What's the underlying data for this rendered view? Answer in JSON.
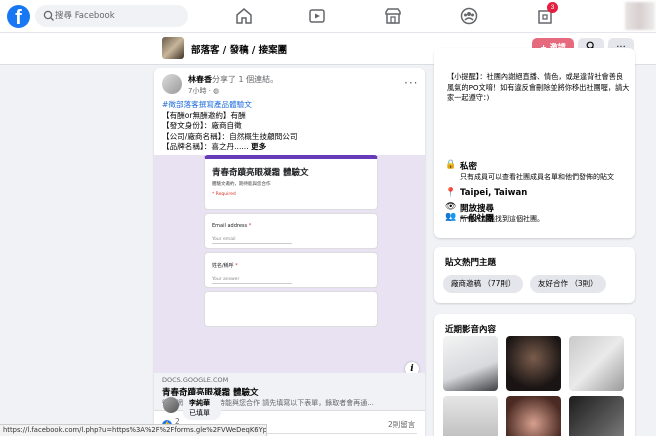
{
  "nav": {
    "logo_letter": "f",
    "search_placeholder": "搜尋 Facebook",
    "notification_count": "3"
  },
  "group": {
    "name": "部落客 / 發稿 / 接案團",
    "invite_label": "+ 邀請",
    "search_btn": "⌕",
    "more_btn": "···"
  },
  "post": {
    "author": "林春香",
    "action": "分享了 1 個連結。",
    "time": "7小時 · ",
    "more": "···",
    "tag": "#徵部落客撰寫產品體驗文",
    "lines": [
      "【有酬or無酬邀約】有酬",
      "【發文身份】：廠商自徵",
      "【公司/廠商名稱】：自然概生技顧問公司"
    ],
    "last_line": "【品牌名稱】：喜之丹...... ",
    "see_more": "更多",
    "form": {
      "title": "青春奇蹟亮眼凝霜 體驗文",
      "desc": "體驗文邀約，期待能與您合作",
      "required": "* Required",
      "field1_label": "Email address",
      "field1_placeholder": "Your email",
      "field2_label": "姓名/稱呼",
      "field2_placeholder": "Your answer"
    },
    "info_icon": "i",
    "link": {
      "domain": "DOCS.GOOGLE.COM",
      "title": "青春奇蹟亮眼凝霜 體驗文",
      "desc": "徵求網紅網美，期待能與您合作 請先填寫以下表單，錄取者會再通..."
    },
    "reaction_count": "2",
    "comment_count": "2則留言",
    "like_label": "讚",
    "comment_label": "留言",
    "comment": {
      "name": "李純華",
      "text": "已填單"
    }
  },
  "statusbar": "https://l.facebook.com/l.php?u=https%3A%2F%2Fforms.gle%2FVWeDeqK6YpJT...",
  "about": {
    "rules": "【小提醒】：社團內謝絕直播、情色，或是違背社會善良風氣的PO文唷！如有違反會刪除並將你移出社團喔，請大家一起遵守：)",
    "private_title": "私密",
    "private_desc": "只有成員可以查看社團成員名單和他們發佈的貼文",
    "visible_title": "開放搜尋",
    "visible_desc": "所有人都能找到這個社團。",
    "location": "Taipei, Taiwan",
    "type": "一般社團"
  },
  "topics": {
    "title": "貼文熱門主題",
    "chips": [
      "廠商邀稿 （77則）",
      "友好合作 （3則）"
    ]
  },
  "media": {
    "title": "近期影音內容"
  }
}
